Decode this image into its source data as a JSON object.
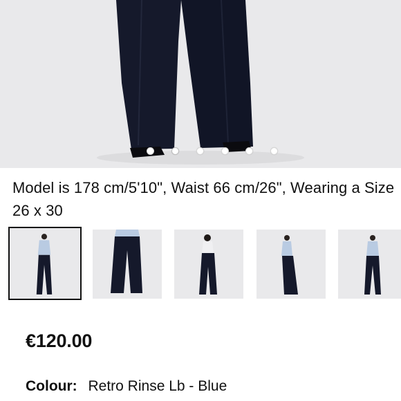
{
  "product": {
    "model_info": "Model is 178 cm/5'10\", Waist 66 cm/26\", Wearing a Size 26 x 30",
    "price": "€120.00",
    "colour_label": "Colour:",
    "colour_value": "Retro Rinse Lb - Blue"
  },
  "gallery": {
    "image_count": 6,
    "active_index": 1,
    "thumbnails": [
      {
        "view": "front"
      },
      {
        "view": "front-legs"
      },
      {
        "view": "back"
      },
      {
        "view": "side"
      },
      {
        "view": "front"
      }
    ],
    "selected_thumbnail": 0
  },
  "colors": {
    "jeans": "#15192b",
    "shirt": "#b9cbe2",
    "background": "#e9e9eb",
    "text": "#111111"
  }
}
